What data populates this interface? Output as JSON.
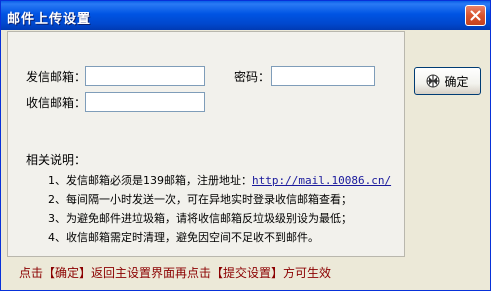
{
  "window": {
    "title": "邮件上传设置"
  },
  "form": {
    "sender_label": "发信邮箱：",
    "sender_value": "",
    "password_label": "密码：",
    "password_value": "",
    "receiver_label": "收信邮箱：",
    "receiver_value": ""
  },
  "notes": {
    "title": "相关说明：",
    "item1_prefix": "1、发信邮箱必须是139邮箱，注册地址：",
    "item1_link": "http://mail.10086.cn/",
    "item2": "2、每间隔一小时发送一次，可在异地实时登录收信邮箱查看；",
    "item3": "3、为避免邮件进垃圾箱，请将收信邮箱反垃圾级别设为最低；",
    "item4": "4、收信邮箱需定时清理，避免因空间不足收不到邮件。"
  },
  "buttons": {
    "confirm_label": "确定"
  },
  "footer": {
    "text": "点击【确定】返回主设置界面再点击【提交设置】方可生效"
  },
  "icons": {
    "close": "close-icon",
    "confirm": "confirm-icon"
  },
  "colors": {
    "titlebar": "#0054e3",
    "footer_text": "#8b0000",
    "link": "#1a1a9c"
  }
}
